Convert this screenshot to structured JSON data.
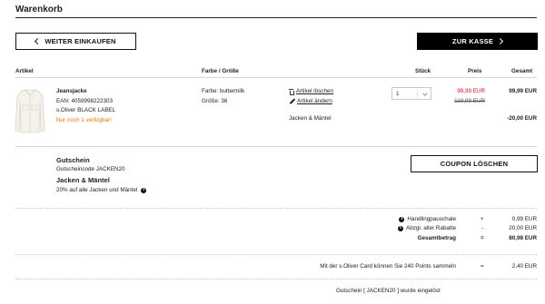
{
  "page": {
    "title": "Warenkorb"
  },
  "nav": {
    "continue_label": "WEITER EINKAUFEN",
    "checkout_label": "ZUR KASSE"
  },
  "table": {
    "headers": {
      "article": "Artikel",
      "color_size": "Farbe / Größe",
      "quantity": "Stück",
      "price": "Preis",
      "total": "Gesamt"
    }
  },
  "item": {
    "name": "Jeansjacke",
    "ean": "EAN: 4059998222303",
    "brand": "s.Oliver BLACK LABEL",
    "stock": "Nur noch 1 verfügbar!",
    "color": "Farbe: buttermilk",
    "size": "Größe: 36",
    "delete_label": "Artikel löschen",
    "edit_label": "Artikel ändern",
    "category": "Jacken & Mäntel",
    "quantity": "1",
    "price_sale": "99,99 EUR",
    "price_original": "119,99 EUR",
    "total": "99,99 EUR",
    "discount": "-20,00 EUR"
  },
  "coupon": {
    "heading": "Gutschein",
    "code_line": "Gutscheincode JACKEN20",
    "category": "Jacken & Mäntel",
    "description": "20% auf alle Jacken und Mäntel",
    "remove_label": "COUPON LÖSCHEN"
  },
  "summary": {
    "rows": [
      {
        "label": "Handlingpauschale",
        "op": "+",
        "value": "0,99 EUR",
        "info": true,
        "bold": false
      },
      {
        "label": "Abzgl. aller Rabatte",
        "op": "-",
        "value": "20,00 EUR",
        "info": true,
        "bold": false
      },
      {
        "label": "Gesamtbetrag",
        "op": "=",
        "value": "80,98 EUR",
        "info": false,
        "bold": true
      }
    ],
    "points_text": "Mit der s.Oliver Card können Sie 240 Points sammeln",
    "points_op": "=",
    "points_value": "2,40 EUR"
  },
  "notice": "Gutschein [ JACKEN20 ] wurde eingelöst",
  "colors": {
    "accent_orange": "#e07b00",
    "sale_red": "#c8101e"
  },
  "icons": [
    "chevron-left-icon",
    "chevron-right-icon",
    "trash-icon",
    "pencil-icon",
    "info-icon",
    "chevron-down-icon"
  ]
}
